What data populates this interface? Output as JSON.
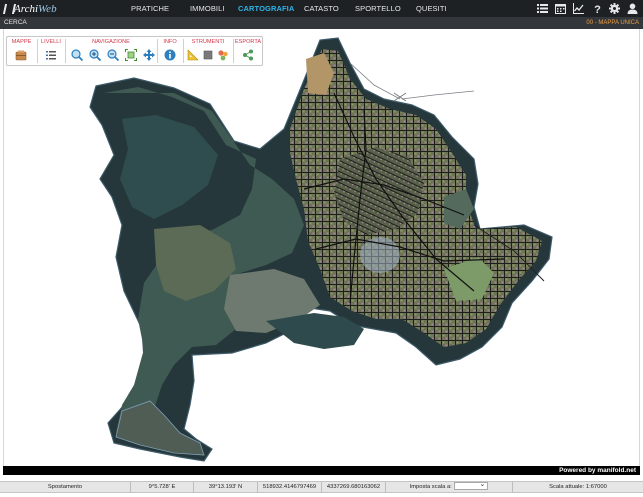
{
  "app": {
    "logo_a": "Archi",
    "logo_b": "Web"
  },
  "nav": {
    "items": [
      {
        "label": "PRATICHE",
        "active": false
      },
      {
        "label": "IMMOBILI",
        "active": false
      },
      {
        "label": "CARTOGRAFIA",
        "active": true
      },
      {
        "label": "CATASTO",
        "active": false
      },
      {
        "label": "SPORTELLO",
        "active": false
      },
      {
        "label": "QUESITI",
        "active": false
      }
    ],
    "icons": [
      "list-icon",
      "calendar-icon",
      "chart-icon",
      "help-icon",
      "settings-icon",
      "user-icon"
    ]
  },
  "subbar": {
    "search_label": "CERCA",
    "map_name": "00 - MAPPA UNICA"
  },
  "toolbar": {
    "groups": [
      {
        "title": "MAPPE",
        "tools": [
          "maps-icon"
        ]
      },
      {
        "title": "LIVELLI",
        "tools": [
          "layers-icon"
        ]
      },
      {
        "title": "NAVIGAZIONE",
        "tools": [
          "zoom-icon",
          "zoom-in-icon",
          "zoom-out-icon",
          "zoom-extent-icon",
          "pan-icon"
        ]
      },
      {
        "title": "INFO",
        "tools": [
          "info-icon"
        ]
      },
      {
        "title": "STRUMENTI",
        "tools": [
          "measure-icon",
          "area-icon",
          "print-icon"
        ]
      },
      {
        "title": "ESPORTA",
        "tools": [
          "share-icon"
        ]
      }
    ]
  },
  "map": {
    "attribution": "Powered by manifold.net"
  },
  "status": {
    "mode": "Spostamento",
    "lon": "9°5.728' E",
    "lat": "39°13.193' N",
    "x": "518932.4146797469",
    "y": "4337269.680163062",
    "set_scale_label": "Imposta scala a:",
    "current_scale": "Scala attuale: 1:67000"
  },
  "colors": {
    "accent": "#2fb3e8",
    "toolbar_title": "#d5374a",
    "map_name": "#f0a040",
    "topbar": "#1e2124"
  }
}
